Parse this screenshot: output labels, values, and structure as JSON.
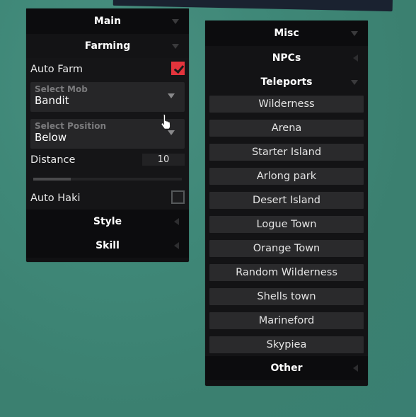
{
  "main_panel": {
    "header": "Main",
    "farming": {
      "header": "Farming",
      "auto_farm": {
        "label": "Auto Farm",
        "checked": true
      },
      "select_mob": {
        "label": "Select Mob",
        "value": "Bandit"
      },
      "select_position": {
        "label": "Select Position",
        "value": "Below"
      },
      "distance": {
        "label": "Distance",
        "value": "10",
        "fill_fraction": 0.25
      },
      "auto_haki": {
        "label": "Auto Haki",
        "checked": false
      }
    },
    "style_header": "Style",
    "skill_header": "Skill"
  },
  "misc_panel": {
    "header": "Misc",
    "npcs_header": "NPCs",
    "teleports": {
      "header": "Teleports",
      "items": [
        "Wilderness",
        "Arena",
        "Starter Island",
        "Arlong park",
        "Desert Island",
        "Logue Town",
        "Orange Town",
        "Random Wilderness",
        "Shells town",
        "Marineford",
        "Skypiea"
      ]
    },
    "other_header": "Other"
  },
  "colors": {
    "accent_checked": "#e3343c",
    "panel_bg": "#111113",
    "button_bg": "#2a2a2c",
    "background": "#3f8878"
  }
}
